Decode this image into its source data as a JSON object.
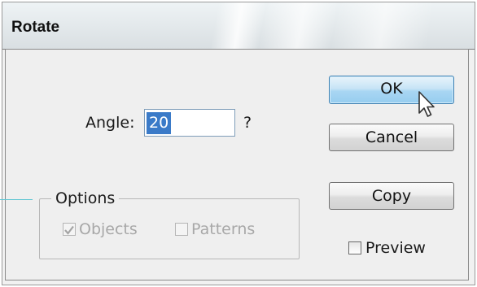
{
  "window": {
    "title": "Rotate"
  },
  "angle": {
    "label": "Angle:",
    "value": "20",
    "unit": "?"
  },
  "buttons": {
    "ok": "OK",
    "cancel": "Cancel",
    "copy": "Copy"
  },
  "options": {
    "legend": "Options",
    "objects": {
      "label": "Objects",
      "checked": true,
      "enabled": false
    },
    "patterns": {
      "label": "Patterns",
      "checked": false,
      "enabled": false
    }
  },
  "preview": {
    "label": "Preview",
    "checked": false
  }
}
